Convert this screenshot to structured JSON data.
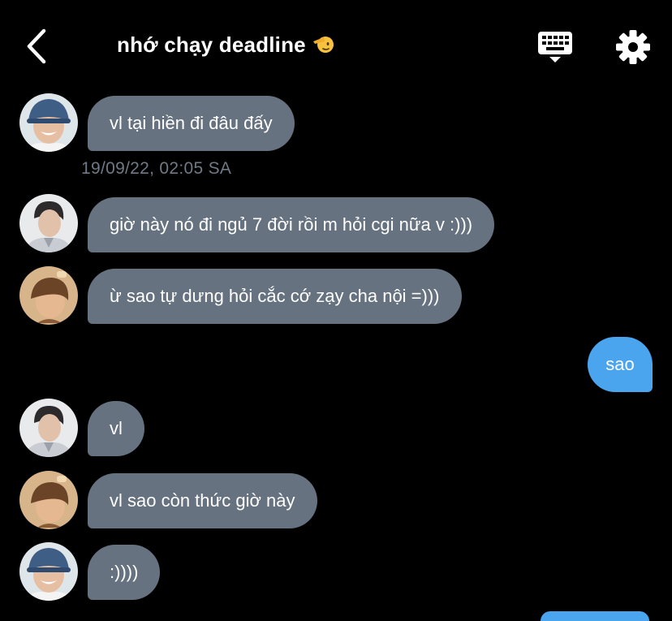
{
  "header": {
    "title": "nhớ chạy deadline",
    "back_icon": "chevron-left-icon",
    "keyboard_icon": "keyboard-icon",
    "settings_icon": "gear-icon"
  },
  "colors": {
    "background": "#000000",
    "incoming_bubble": "#66727f",
    "outgoing_bubble": "#4ba4ee",
    "timestamp": "#6f7a86"
  },
  "messages": [
    {
      "sender": "a",
      "direction": "in",
      "text": "vl tại hiền đi đâu đấy"
    },
    {
      "type": "timestamp",
      "text": "19/09/22, 02:05 SA"
    },
    {
      "sender": "b",
      "direction": "in",
      "text": "giờ này nó đi ngủ 7 đời rồi m hỏi cgi nữa v :)))"
    },
    {
      "sender": "c",
      "direction": "in",
      "text": "ừ sao tự dưng hỏi cắc cớ zạy cha nội =)))"
    },
    {
      "sender": "me",
      "direction": "out",
      "text": "sao"
    },
    {
      "sender": "b",
      "direction": "in",
      "text": "vl"
    },
    {
      "sender": "c",
      "direction": "in",
      "text": "vl sao còn thức giờ này"
    },
    {
      "sender": "a",
      "direction": "in",
      "text": ":))))"
    }
  ]
}
